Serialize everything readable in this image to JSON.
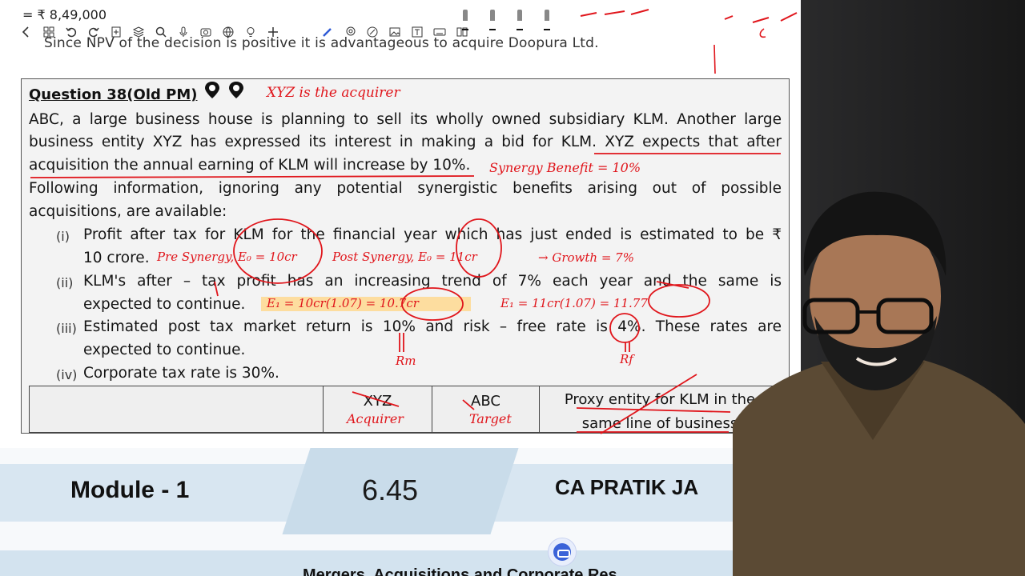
{
  "toolbar": {
    "prev_amount": "= ₹ 8,49,000",
    "tools": [
      "back-icon",
      "grid-icon",
      "undo-icon",
      "redo-icon",
      "add-page-icon",
      "layers-icon",
      "search-icon",
      "mic-icon",
      "camera-icon",
      "globe-icon",
      "lightbulb-icon",
      "plus-icon",
      "pen-icon",
      "lasso-icon",
      "eraser-icon",
      "image-icon",
      "text-icon",
      "keyboard-icon",
      "book-icon"
    ]
  },
  "previous_line": "Since NPV of  the decision is positive it is advantageous to acquire Doopura Ltd.",
  "question": {
    "title": "Question 38(Old PM)",
    "para1_line1": "ABC, a large business house is planning to sell its wholly owned subsidiary KLM. Another large",
    "para1_line2": "business entity XYZ has expressed its interest in making a bid for KLM. XYZ expects that after",
    "para1_line3": "acquisition the annual earning of KLM will increase by 10%.",
    "para2_line1": "Following information, ignoring any potential synergistic benefits arising out of possible",
    "para2_line2": "acquisitions, are available:",
    "items": [
      {
        "num": "(i)",
        "line1": "Profit after tax for KLM for the financial year which has just ended is estimated to be ₹",
        "line2": "10 crore."
      },
      {
        "num": "(ii)",
        "line1": "KLM's after – tax profit has an increasing trend of 7% each year and the same is",
        "line2": "expected to continue."
      },
      {
        "num": "(iii)",
        "line1": "Estimated post tax market return is 10% and risk – free rate is 4%. These rates are",
        "line2": "expected to continue."
      },
      {
        "num": "(iv)",
        "line1": "Corporate tax rate is 30%.",
        "line2": ""
      }
    ],
    "table_headers": [
      "",
      "XYZ",
      "ABC",
      "Proxy entity for KLM in the same line of business"
    ]
  },
  "handwriting": {
    "acquirer_note": "XYZ is the acquirer",
    "synergy": "Synergy Benefit = 10%",
    "pre_synergy": "Pre Synergy, E₀ = 10cr",
    "post_synergy": "Post Synergy, E₀ = 11cr",
    "growth": "→ Growth = 7%",
    "e1_pre": "E₁ = 10cr(1.07) = 10.7cr",
    "e1_post": "E₁ = 11cr(1.07) = 11.77",
    "rm": "Rm",
    "rf": "Rf",
    "acquirer": "Acquirer",
    "target": "Target"
  },
  "footer": {
    "module": "Module - 1",
    "page_number": "6.45",
    "author": "CA PRATIK JA",
    "book_title": "Mergers, Acquisitions and Corporate Res"
  },
  "colors": {
    "ink": "#e0151b",
    "highlight": "#ffd78a",
    "footer_band": "#d8e6f1"
  }
}
